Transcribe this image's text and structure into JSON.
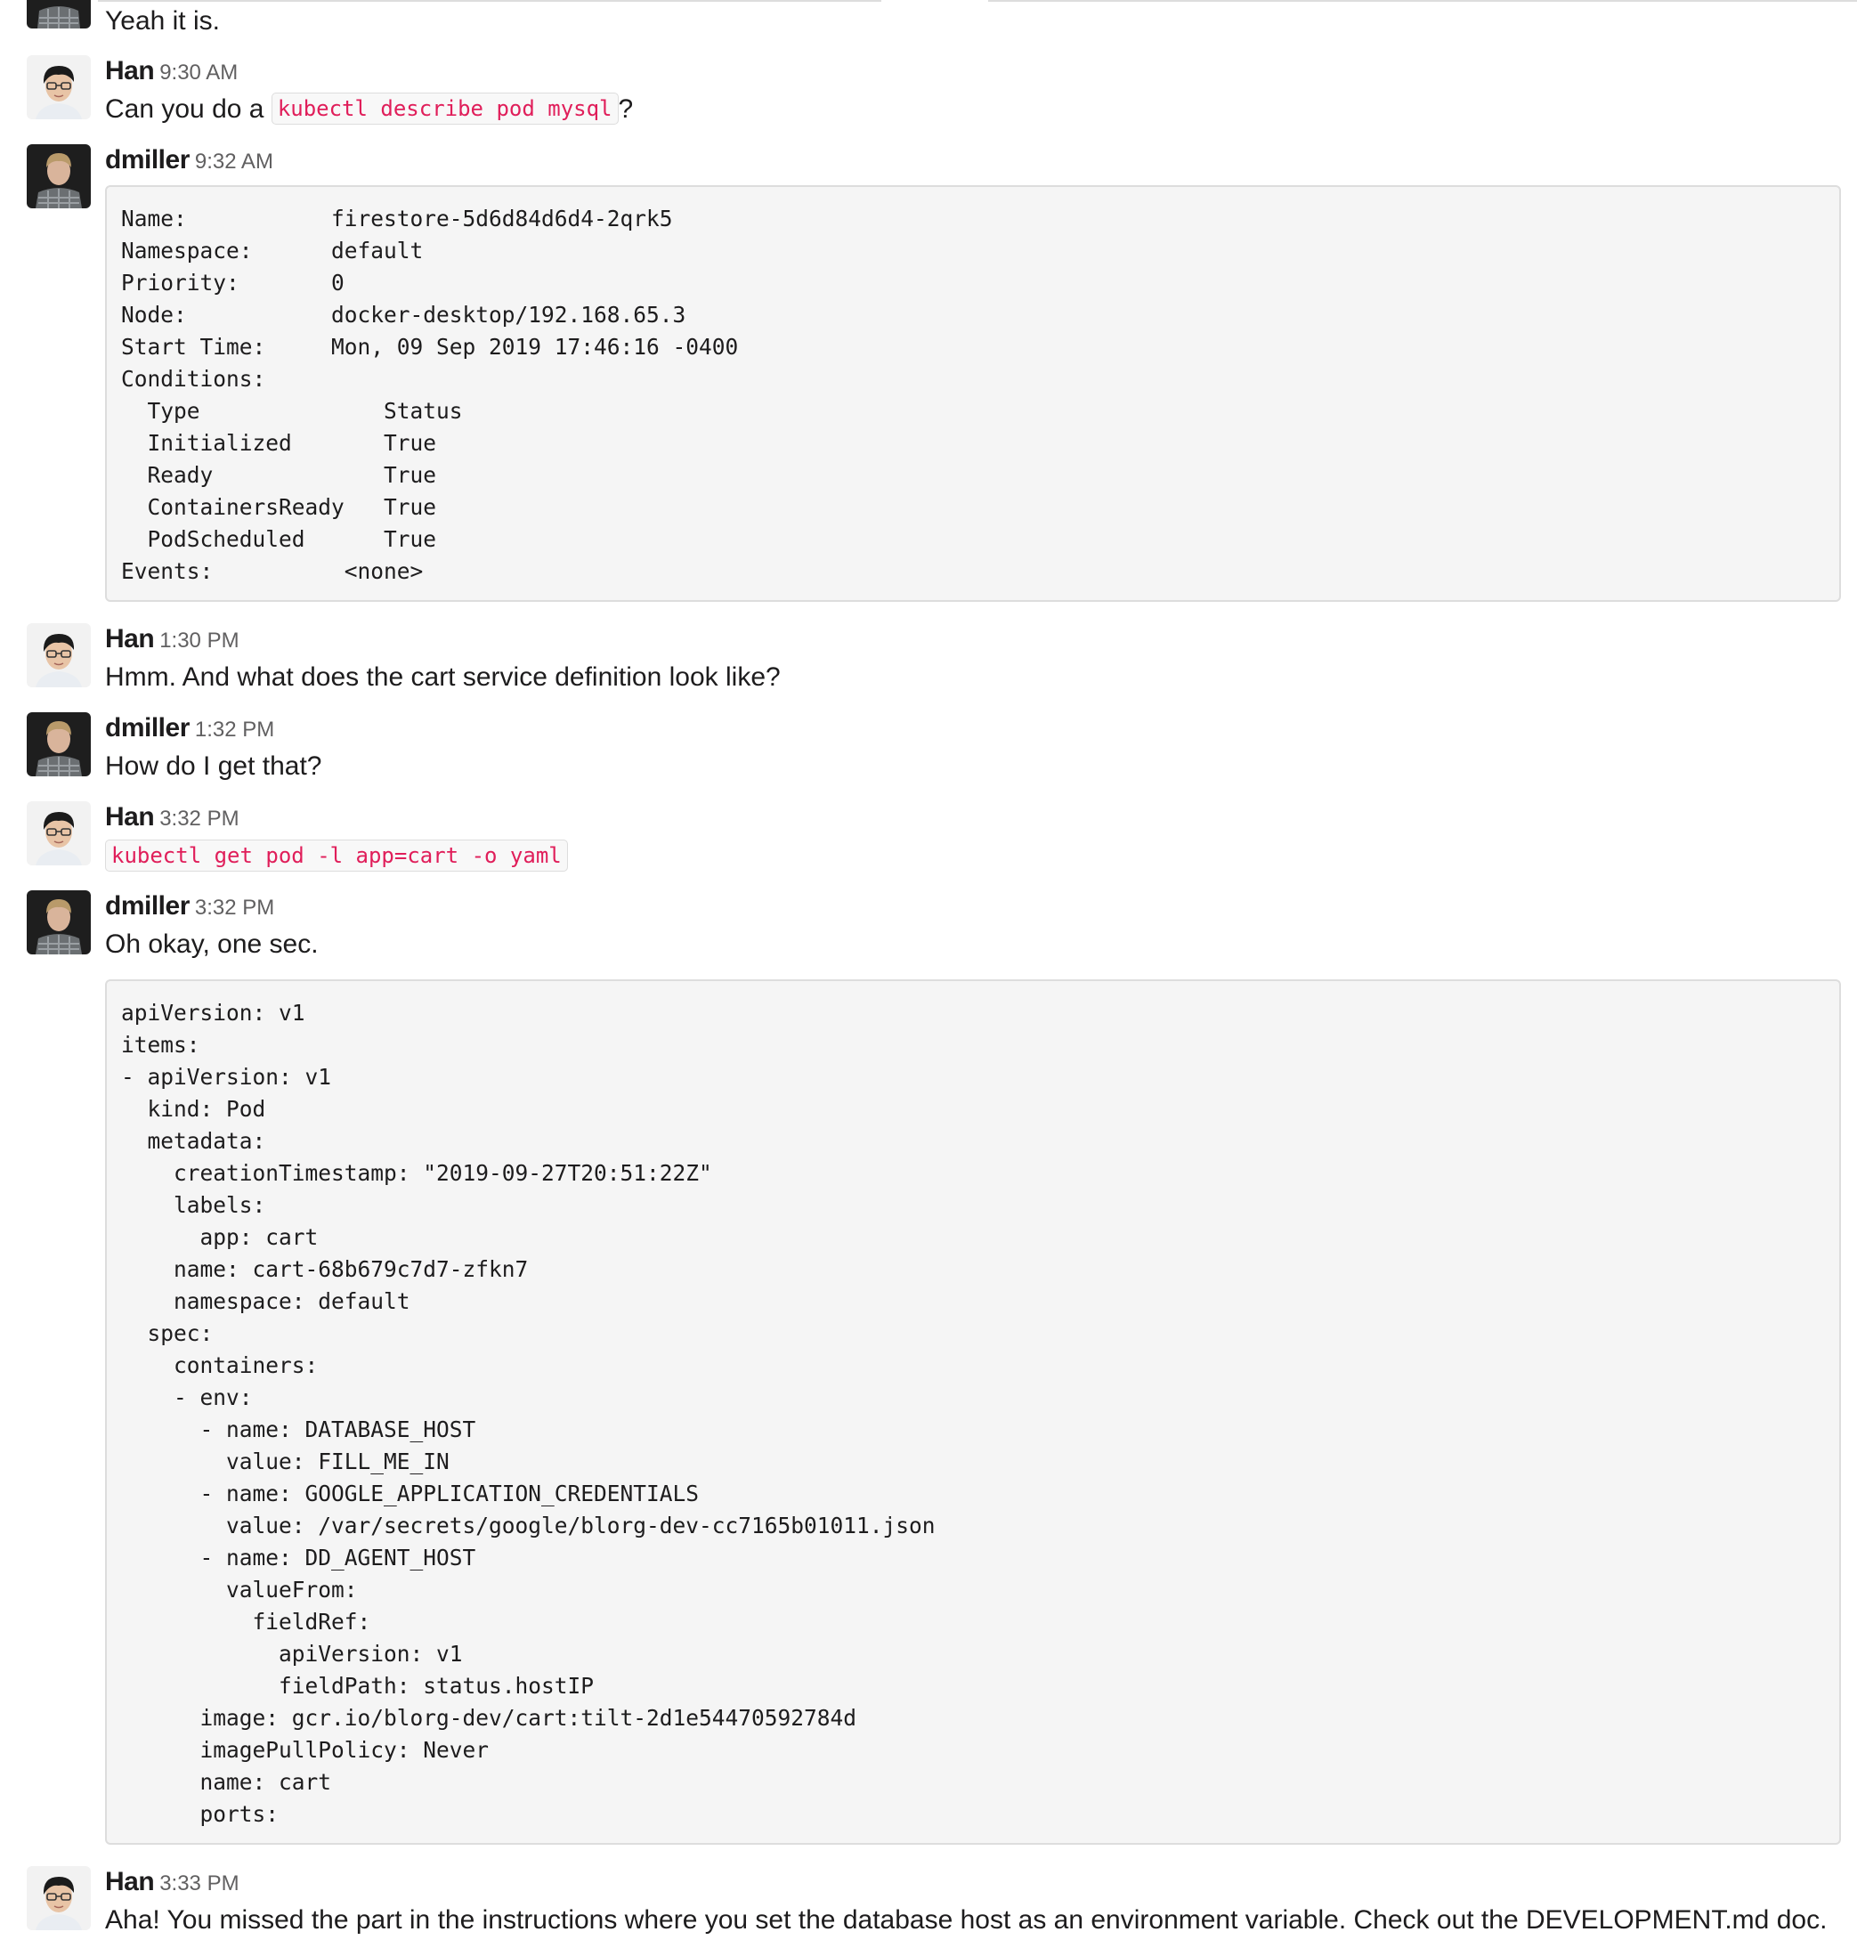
{
  "messages": [
    {
      "author": "",
      "time": "",
      "text": "Yeah it is."
    },
    {
      "author": "Han",
      "time": "9:30 AM",
      "text_before": "Can you do a",
      "code": "kubectl describe pod mysql",
      "text_after": "?"
    },
    {
      "author": "dmiller",
      "time": "9:32 AM"
    },
    {
      "author": "Han",
      "time": "1:30 PM",
      "text": "Hmm. And what does the cart service definition look like?"
    },
    {
      "author": "dmiller",
      "time": "1:32 PM",
      "text": "How do I get that?"
    },
    {
      "author": "Han",
      "time": "3:32 PM",
      "code": "kubectl get pod -l app=cart -o yaml"
    },
    {
      "author": "dmiller",
      "time": "3:32 PM",
      "text": "Oh okay, one sec."
    },
    {
      "author": "Han",
      "time": "3:33 PM",
      "text": "Aha! You missed the part in the instructions where you set the database host as an environment variable. Check out the DEVELOPMENT.md doc."
    }
  ],
  "describe_output": [
    "Name:           firestore-5d6d84d6d4-2qrk5",
    "Namespace:      default",
    "Priority:       0",
    "Node:           docker-desktop/192.168.65.3",
    "Start Time:     Mon, 09 Sep 2019 17:46:16 -0400",
    "Conditions:",
    "  Type              Status",
    "  Initialized       True",
    "  Ready             True",
    "  ContainersReady   True",
    "  PodScheduled      True",
    "Events:          <none>"
  ],
  "yaml_output": [
    "apiVersion: v1",
    "items:",
    "- apiVersion: v1",
    "  kind: Pod",
    "  metadata:",
    "    creationTimestamp: \"2019-09-27T20:51:22Z\"",
    "    labels:",
    "      app: cart",
    "    name: cart-68b679c7d7-zfkn7",
    "    namespace: default",
    "  spec:",
    "    containers:",
    "    - env:",
    "      - name: DATABASE_HOST",
    "        value: FILL_ME_IN",
    "      - name: GOOGLE_APPLICATION_CREDENTIALS",
    "        value: /var/secrets/google/blorg-dev-cc7165b01011.json",
    "      - name: DD_AGENT_HOST",
    "        valueFrom:",
    "          fieldRef:",
    "            apiVersion: v1",
    "            fieldPath: status.hostIP",
    "      image: gcr.io/blorg-dev/cart:tilt-2d1e54470592784d",
    "      imagePullPolicy: Never",
    "      name: cart",
    "      ports:"
  ],
  "icons": {
    "han_avatar": "avatar-han-icon",
    "dmiller_avatar": "avatar-dmiller-icon"
  },
  "colors": {
    "inline_code": "#e01e5a",
    "code_bg": "#f5f5f5",
    "border": "#dddddd",
    "time": "#616061"
  }
}
